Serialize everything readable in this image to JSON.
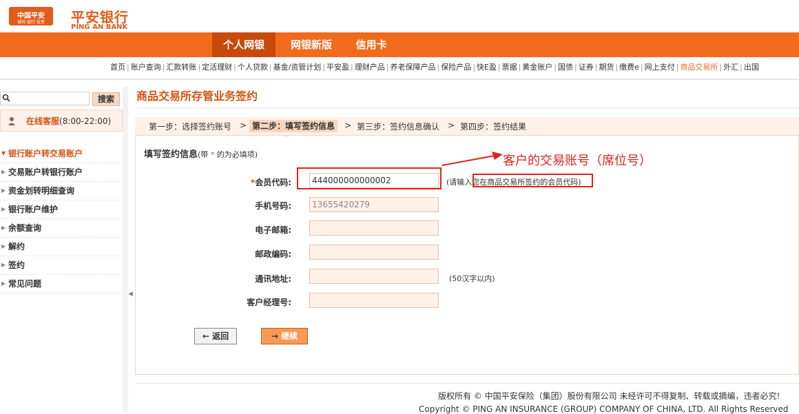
{
  "logo": {
    "box_text": "中国平安",
    "box_sub": "保险·银行·投资",
    "name_cn": "平安银行",
    "name_en": "PING AN BANK"
  },
  "top_nav": [
    "个人网银",
    "网银新版",
    "信用卡"
  ],
  "sub_nav": [
    "首页",
    "账户查询",
    "汇款转账",
    "定活理财",
    "个人贷款",
    "基金/资管计划",
    "平安盈",
    "理财产品",
    "养老保障产品",
    "保险产品",
    "快E盈",
    "票据",
    "黄金账户",
    "国债",
    "证券",
    "期货",
    "缴费e",
    "网上支付",
    "商品交易所",
    "外汇",
    "出国"
  ],
  "sub_nav_highlight": "商品交易所",
  "sidebar": {
    "search_button": "搜索",
    "service_label": "在线客服",
    "service_time": "(8:00-22:00)",
    "menu": [
      {
        "label": "银行账户转交易账户",
        "active": true
      },
      {
        "label": "交易账户转银行账户",
        "active": false
      },
      {
        "label": "资金划转明细查询",
        "active": false
      },
      {
        "label": "银行账户维护",
        "active": false
      },
      {
        "label": "余额查询",
        "active": false
      },
      {
        "label": "解约",
        "active": false
      },
      {
        "label": "签约",
        "active": false
      },
      {
        "label": "常见问题",
        "active": false
      }
    ]
  },
  "main": {
    "title": "商品交易所存管业务签约",
    "steps": [
      "第一步：选择签约账号",
      "第二步：填写签约信息",
      "第三步：签约信息确认",
      "第四步：签约结果"
    ],
    "step_separator": ">",
    "current_step": 1,
    "form_heading": "填写签约信息",
    "form_hint_prefix": "(带",
    "form_hint_star": "*",
    "form_hint_suffix": "的为必填项)",
    "fields": {
      "member_code": {
        "label": "会员代码:",
        "required_mark": "*",
        "value": "444000000000002"
      },
      "mobile": {
        "label": "手机号码:",
        "value": "13655420279"
      },
      "email": {
        "label": "电子邮箱:",
        "value": ""
      },
      "postcode": {
        "label": "邮政编码:",
        "value": ""
      },
      "address": {
        "label": "通讯地址:",
        "value": ""
      },
      "manager_no": {
        "label": "客户经理号:",
        "value": ""
      }
    },
    "member_note_prefix": "(请输入",
    "member_note_boxed": "您在商品交易所签约的会员代码",
    "member_note_suffix": ")",
    "address_note": "(50汉字以内)",
    "annotation": "客户的交易账号（席位号）",
    "back_button": "返回",
    "next_button": "继续"
  },
  "footer": {
    "copyright_cn": "版权所有 © 中国平安保险（集团）股份有限公司 未经许可不得复制、转载或摘编，违者必究!",
    "copyright_en": "Copyright © PING AN INSURANCE (GROUP) COMPANY OF CHINA, LTD. All Rights Reserved"
  }
}
